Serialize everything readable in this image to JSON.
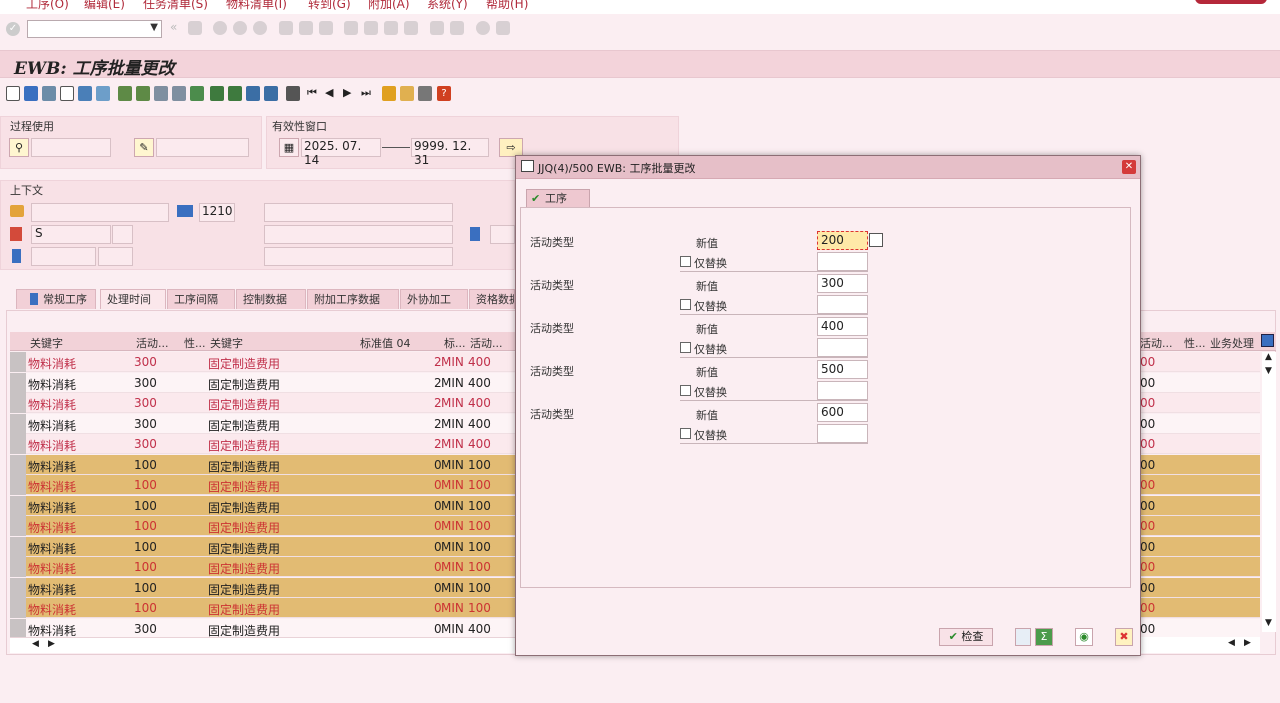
{
  "menu": [
    "工序(O)",
    "编辑(E)",
    "任务清单(S)",
    "物料清单(I)",
    "转到(G)",
    "附加(A)",
    "系统(Y)",
    "帮助(H)"
  ],
  "title": "EWB: 工序批量更改",
  "process_use": {
    "label": "过程使用"
  },
  "validity": {
    "label": "有效性窗口",
    "from": "2025. 07. 14",
    "to": "9999. 12. 31"
  },
  "context": {
    "label": "上下文",
    "plant": "1210",
    "type": "S"
  },
  "tabs": [
    "常规工序",
    "处理时间",
    "工序间隔",
    "控制数据",
    "附加工序数据",
    "外协加工",
    "资格数据"
  ],
  "grid": {
    "headers": [
      "关键字",
      "活动...",
      "性...",
      "关键字",
      "标准值 04",
      "标...",
      "活动..."
    ],
    "rows": [
      {
        "k1": "物料消耗",
        "act": "300",
        "k2": "固定制造费用",
        "val": "2",
        "unit": "MIN",
        "act2": "400",
        "style": "pink"
      },
      {
        "k1": "物料消耗",
        "act": "300",
        "k2": "固定制造费用",
        "val": "2",
        "unit": "MIN",
        "act2": "400",
        "style": "normal"
      },
      {
        "k1": "物料消耗",
        "act": "300",
        "k2": "固定制造费用",
        "val": "2",
        "unit": "MIN",
        "act2": "400",
        "style": "pink"
      },
      {
        "k1": "物料消耗",
        "act": "300",
        "k2": "固定制造费用",
        "val": "2",
        "unit": "MIN",
        "act2": "400",
        "style": "normal"
      },
      {
        "k1": "物料消耗",
        "act": "300",
        "k2": "固定制造费用",
        "val": "2",
        "unit": "MIN",
        "act2": "400",
        "style": "pink"
      },
      {
        "k1": "物料消耗",
        "act": "100",
        "k2": "固定制造费用",
        "val": "0",
        "unit": "MIN",
        "act2": "100",
        "style": "orange"
      },
      {
        "k1": "物料消耗",
        "act": "100",
        "k2": "固定制造费用",
        "val": "0",
        "unit": "MIN",
        "act2": "100",
        "style": "orange-red"
      },
      {
        "k1": "物料消耗",
        "act": "100",
        "k2": "固定制造费用",
        "val": "0",
        "unit": "MIN",
        "act2": "100",
        "style": "orange"
      },
      {
        "k1": "物料消耗",
        "act": "100",
        "k2": "固定制造费用",
        "val": "0",
        "unit": "MIN",
        "act2": "100",
        "style": "orange-red"
      },
      {
        "k1": "物料消耗",
        "act": "100",
        "k2": "固定制造费用",
        "val": "0",
        "unit": "MIN",
        "act2": "100",
        "style": "orange"
      },
      {
        "k1": "物料消耗",
        "act": "100",
        "k2": "固定制造费用",
        "val": "0",
        "unit": "MIN",
        "act2": "100",
        "style": "orange-red"
      },
      {
        "k1": "物料消耗",
        "act": "100",
        "k2": "固定制造费用",
        "val": "0",
        "unit": "MIN",
        "act2": "100",
        "style": "orange"
      },
      {
        "k1": "物料消耗",
        "act": "100",
        "k2": "固定制造费用",
        "val": "0",
        "unit": "MIN",
        "act2": "100",
        "style": "orange-red"
      },
      {
        "k1": "物料消耗",
        "act": "300",
        "k2": "固定制造费用",
        "val": "0",
        "unit": "MIN",
        "act2": "400",
        "style": "normal"
      }
    ],
    "right_headers": [
      "活动...",
      "性...",
      "业务处理"
    ],
    "right_values": [
      "00",
      "00",
      "00",
      "00",
      "00",
      "00",
      "00",
      "00",
      "00",
      "00",
      "00",
      "00",
      "00",
      "00"
    ]
  },
  "dialog": {
    "title": "JJQ(4)/500 EWB: 工序批量更改",
    "tab": "工序",
    "rows": [
      {
        "label": "活动类型",
        "new_label": "新值",
        "value": "200",
        "replace_label": "仅替换"
      },
      {
        "label": "活动类型",
        "new_label": "新值",
        "value": "300",
        "replace_label": "仅替换"
      },
      {
        "label": "活动类型",
        "new_label": "新值",
        "value": "400",
        "replace_label": "仅替换"
      },
      {
        "label": "活动类型",
        "new_label": "新值",
        "value": "500",
        "replace_label": "仅替换"
      },
      {
        "label": "活动类型",
        "new_label": "新值",
        "value": "600",
        "replace_label": "仅替换"
      }
    ],
    "check_label": "检查"
  },
  "colors": {
    "pink_text": "#c0304a",
    "orange_bg": "#e2bb73",
    "orange_text": "#c33",
    "normal_text": "#222",
    "row_pink": "#fbe9ed"
  }
}
